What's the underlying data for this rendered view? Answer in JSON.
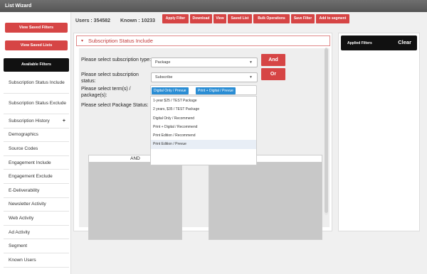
{
  "window": {
    "title": "List Wizard"
  },
  "left": {
    "view_saved_filters": "View Saved Filters",
    "view_saved_lists": "View Saved Lists",
    "available_filters": "Available Filters",
    "items": [
      "Subscription Status Include",
      "Subscription Status Exclude",
      "Subscription History",
      "Demographics",
      "Source Codes",
      "Engagement Include",
      "Engagement Exclude",
      "E-Deliverability",
      "Newsletter Activity",
      "Web Activity",
      "Ad Activity",
      "Segment",
      "Known Users"
    ],
    "expand_symbol": "+"
  },
  "stats": {
    "users": "Users : 354582",
    "known": "Known : 10233"
  },
  "toolbar": {
    "apply_filter": "Apply Filter",
    "download": "Download",
    "view": "View",
    "saved_list": "Saved List",
    "bulk_operations": "Bulk Operations",
    "save_filter": "Save Filter",
    "add_to_segment": "Add to segment"
  },
  "panel": {
    "title": "Subscription Status Include",
    "collapse_symbol": "▾",
    "type_label": "Please select subscription type:",
    "type_value": "Package",
    "status_label": "Please select subscription status:",
    "status_value": "Subscribe",
    "terms_label": "Please select term(s) / package(s):",
    "package_status_label": "Please select Package Status:",
    "selected_terms": [
      "Digital Only / Prevue",
      "Print + Digital / Prevue"
    ],
    "term_options": [
      "1-year $25 / TEST Package",
      "2 years, $35 / TEST Package",
      "Digital Only / Recommend",
      "Print + Digital / Recommend",
      "Print Edition / Recommend",
      "Print Edition / Prevue"
    ],
    "and_button": "And",
    "or_button": "Or",
    "and_column": "AND"
  },
  "right": {
    "applied_filters": "Applied Filters",
    "clear": "Clear"
  },
  "icons": {
    "dropdown_arrow": "▼"
  }
}
